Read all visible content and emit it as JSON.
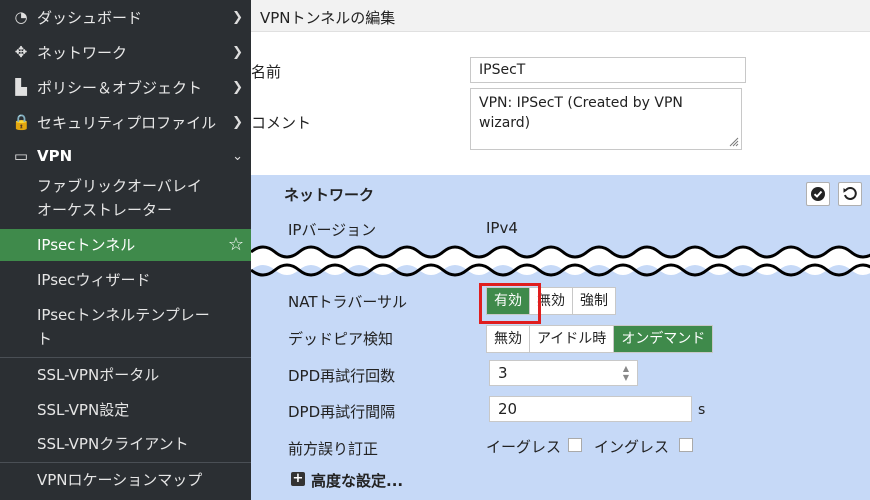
{
  "sidebar": {
    "items": [
      {
        "label": "ダッシュボード",
        "icon": "dashboard-icon",
        "glyph": "◔"
      },
      {
        "label": "ネットワーク",
        "icon": "network-icon",
        "glyph": "✥"
      },
      {
        "label": "ポリシー＆オブジェクト",
        "icon": "policy-icon",
        "glyph": "▙"
      },
      {
        "label": "セキュリティプロファイル",
        "icon": "lock-icon",
        "glyph": "🔒"
      },
      {
        "label": "VPN",
        "icon": "laptop-icon",
        "glyph": "▭"
      }
    ],
    "sub_items": [
      "ファブリックオーバレイ",
      "オーケストレーター",
      "IPsecトンネル",
      "IPsecウィザード",
      "IPsecトンネルテンプレー",
      "ト",
      "SSL-VPNポータル",
      "SSL-VPN設定",
      "SSL-VPNクライアント",
      "VPNロケーションマップ"
    ]
  },
  "header": {
    "title": "VPNトンネルの編集"
  },
  "form": {
    "name_label": "名前",
    "name_value": "IPSecT",
    "comment_label": "コメント",
    "comment_value": "VPN: IPSecT (Created by VPN wizard)"
  },
  "network": {
    "title": "ネットワーク",
    "ip_version_label": "IPバージョン",
    "ip_version_value": "IPv4",
    "nat_label": "NATトラバーサル",
    "nat_options": [
      "有効",
      "無効",
      "強制"
    ],
    "dpd_label": "デッドピア検知",
    "dpd_options": [
      "無効",
      "アイドル時",
      "オンデマンド"
    ],
    "dpd_retry_count_label": "DPD再試行回数",
    "dpd_retry_count_value": "3",
    "dpd_retry_interval_label": "DPD再試行間隔",
    "dpd_retry_interval_value": "20",
    "dpd_retry_interval_unit": "s",
    "fec_label": "前方誤り訂正",
    "fec_egress": "イーグレス",
    "fec_ingress": "イングレス",
    "advanced_label": "高度な設定..."
  },
  "colors": {
    "accent": "#3f8a4b",
    "panel": "#c6d9f7",
    "sidebar": "#2b2f33",
    "highlight": "#e01e1e"
  }
}
